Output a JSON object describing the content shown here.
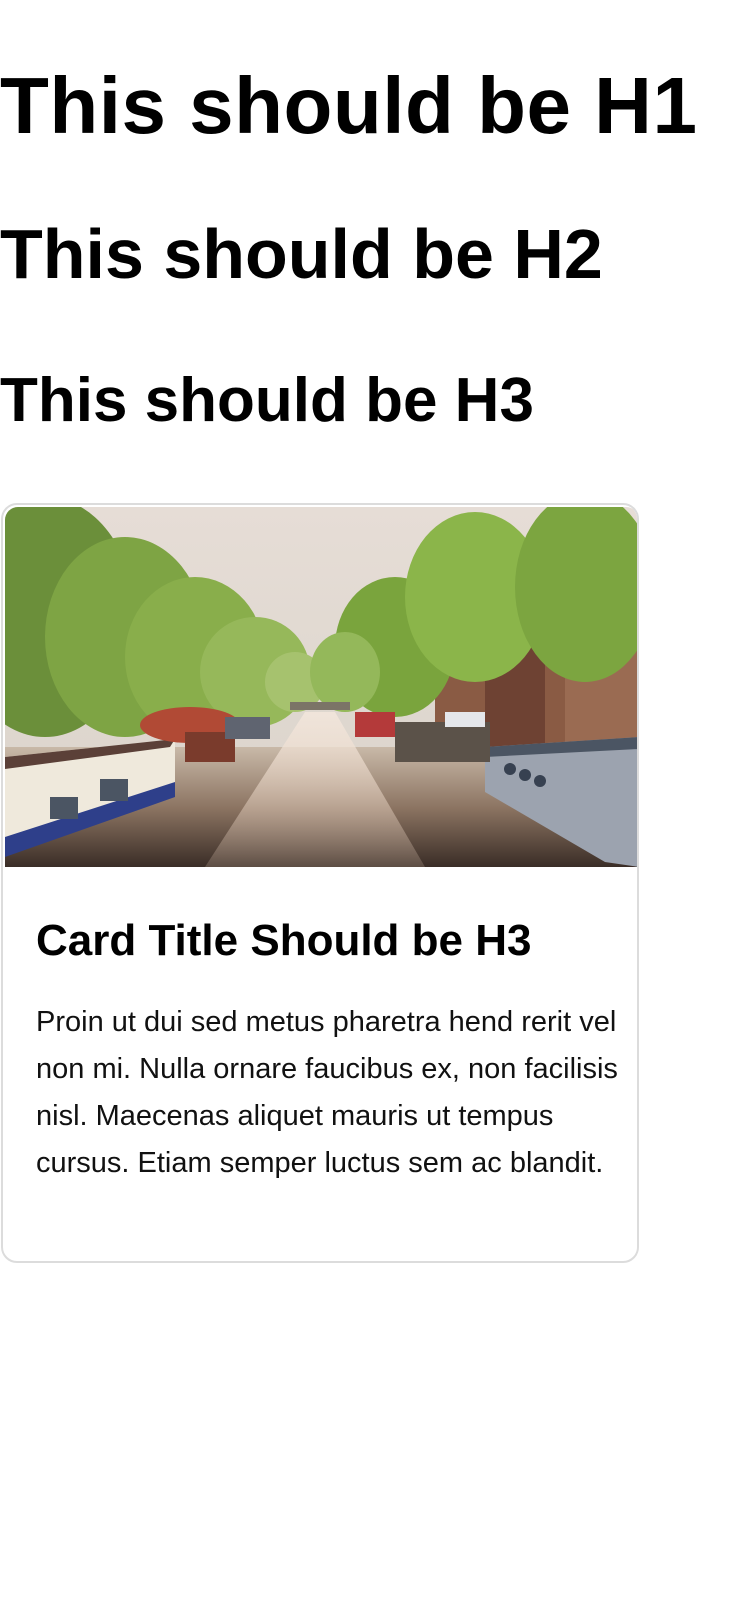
{
  "headings": {
    "h1": "This should be H1",
    "h2": "This should be H2",
    "h3": "This should be H3"
  },
  "card": {
    "image_alt": "Amsterdam canal with houseboats and trees",
    "title": "Card Title Should be H3",
    "body": "Proin ut dui sed metus pharetra hend rerit vel non mi. Nulla ornare faucibus ex, non facilisis nisl. Maecenas aliquet mauris ut tempus cursus. Etiam semper luctus sem ac blandit."
  },
  "colors": {
    "card_border": "#dcdcdc",
    "text": "#000000"
  }
}
